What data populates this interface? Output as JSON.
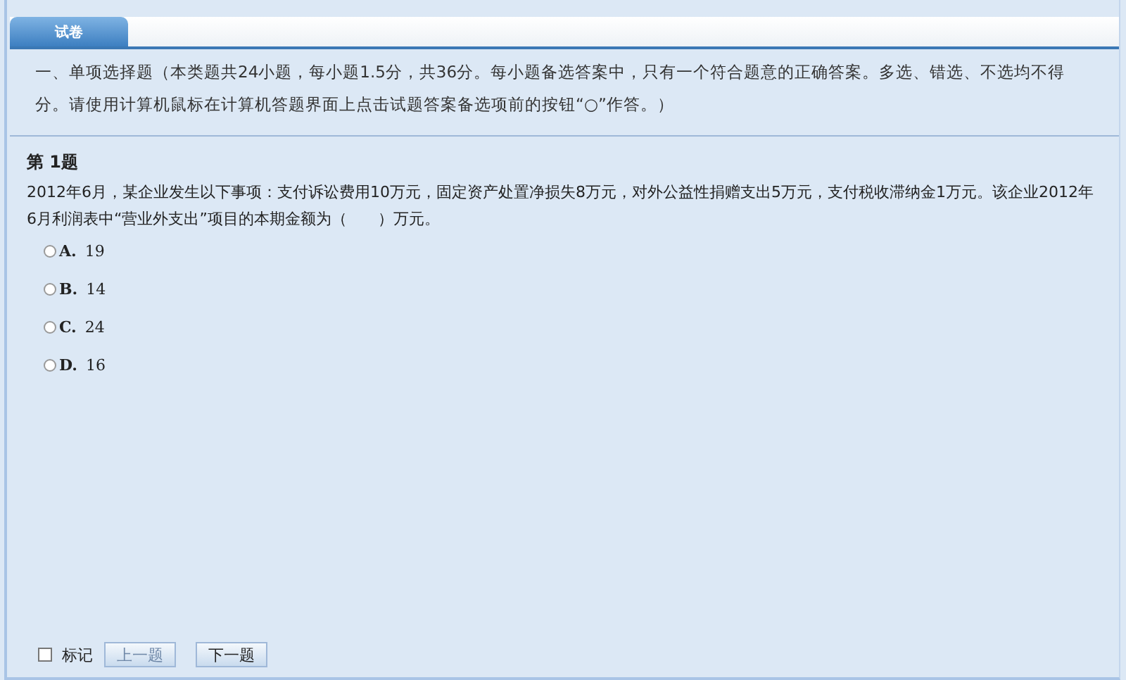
{
  "tabs": [
    {
      "label": "试卷",
      "selected": true
    }
  ],
  "instructions": "一、单项选择题（本类题共24小题，每小题1.5分，共36分。每小题备选答案中，只有一个符合题意的正确答案。多选、错选、不选均不得分。请使用计算机鼠标在计算机答题界面上点击试题答案备选项前的按钮“○”作答。）",
  "question": {
    "number": "第 1题",
    "text": "2012年6月，某企业发生以下事项：支付诉讼费用10万元，固定资产处置净损失8万元，对外公益性捐赠支出5万元，支付税收滞纳金1万元。该企业2012年6月利润表中“营业外支出”项目的本期金额为（　　）万元。",
    "options": [
      {
        "letter": "A.",
        "text": "19",
        "selected": false
      },
      {
        "letter": "B.",
        "text": "14",
        "selected": false
      },
      {
        "letter": "C.",
        "text": "24",
        "selected": false
      },
      {
        "letter": "D.",
        "text": "16",
        "selected": false
      }
    ]
  },
  "footer": {
    "mark": {
      "label": "标记",
      "checked": false
    },
    "buttons": [
      {
        "label": "上一题",
        "disabled": true
      },
      {
        "label": "下一题",
        "disabled": false
      }
    ]
  }
}
